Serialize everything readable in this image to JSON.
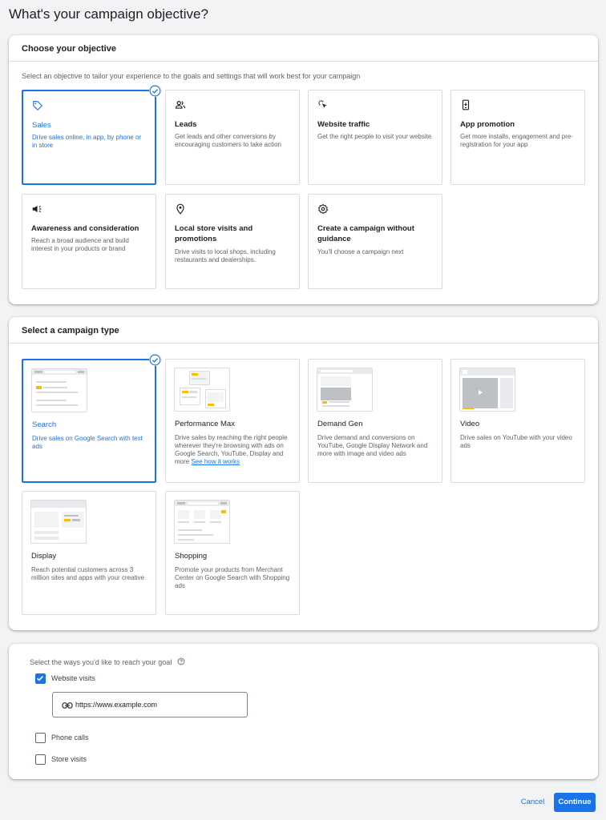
{
  "page_title": "What's your campaign objective?",
  "objective_section": {
    "header": "Choose your objective",
    "description": "Select an objective to tailor your experience to the goals and settings that will work best for your campaign",
    "cards": [
      {
        "title": "Sales",
        "description": "Drive sales online, in app, by phone or in store",
        "icon": "tag-icon",
        "selected": true
      },
      {
        "title": "Leads",
        "description": "Get leads and other conversions by encouraging customers to take action",
        "icon": "people-icon",
        "selected": false
      },
      {
        "title": "Website traffic",
        "description": "Get the right people to visit your website",
        "icon": "cursor-click-icon",
        "selected": false
      },
      {
        "title": "App promotion",
        "description": "Get more installs, engagement and pre-registration for your app",
        "icon": "phone-icon",
        "selected": false
      },
      {
        "title": "Awareness and consideration",
        "description": "Reach a broad audience and build interest in your products or brand",
        "icon": "megaphone-icon",
        "selected": false
      },
      {
        "title": "Local store visits and promotions",
        "description": "Drive visits to local shops, including restaurants and dealerships.",
        "icon": "location-pin-icon",
        "selected": false
      },
      {
        "title": "Create a campaign without guidance",
        "description": "You'll choose a campaign next",
        "icon": "gear-icon",
        "selected": false
      }
    ]
  },
  "campaign_type_section": {
    "header": "Select a campaign type",
    "cards": [
      {
        "title": "Search",
        "description": "Drive sales on Google Search with text ads",
        "selected": true
      },
      {
        "title": "Performance Max",
        "description": "Drive sales by reaching the right people wherever they're browsing with ads on Google Search, YouTube, Display and more",
        "link": "See how it works",
        "selected": false
      },
      {
        "title": "Demand Gen",
        "description": "Drive demand and conversions on YouTube, Google Display Network and more with image and video ads",
        "selected": false
      },
      {
        "title": "Video",
        "description": "Drive sales on YouTube with your video ads",
        "selected": false
      },
      {
        "title": "Display",
        "description": "Reach potential customers across 3 million sites and apps with your creative",
        "selected": false
      },
      {
        "title": "Shopping",
        "description": "Promote your products from Merchant Center on Google Search with Shopping ads",
        "selected": false
      }
    ]
  },
  "goal_section": {
    "label": "Select the ways you'd like to reach your goal",
    "options": [
      {
        "label": "Website visits",
        "checked": true
      },
      {
        "label": "Phone calls",
        "checked": false
      },
      {
        "label": "Store visits",
        "checked": false
      }
    ],
    "url_value": "https://www.example.com"
  },
  "actions": {
    "cancel": "Cancel",
    "continue": "Continue"
  },
  "colors": {
    "accent": "#1a73e8",
    "highlight": "#fbbc04",
    "background": "#f1f3f4"
  }
}
